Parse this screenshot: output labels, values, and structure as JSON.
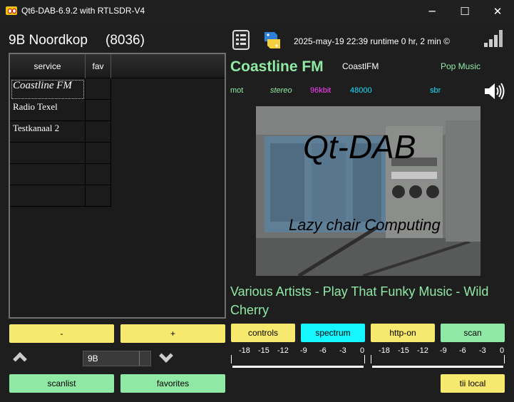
{
  "window": {
    "title": "Qt6-DAB-6.9.2 with RTLSDR-V4",
    "minimize": "─",
    "maximize": "☐",
    "close": "✕"
  },
  "ensemble": {
    "name": "9B Noordkop",
    "id": "(8036)"
  },
  "services": {
    "headers": {
      "service": "service",
      "fav": "fav"
    },
    "rows": [
      "Coastline FM",
      "Radio Texel",
      "Testkanaal 2",
      "",
      "",
      ""
    ]
  },
  "buttons": {
    "minus": "-",
    "plus": "+",
    "scanlist": "scanlist",
    "favorites": "favorites",
    "controls": "controls",
    "spectrum": "spectrum",
    "http": "http-on",
    "scan": "scan",
    "tii": "tii local"
  },
  "channel": {
    "selected": "9B"
  },
  "status": {
    "datetime": "2025-may-19  22:39  runtime 0 hr, 2 min  ©"
  },
  "station": {
    "name": "Coastline FM",
    "short": "CoastlFM",
    "genre": "Pop Music"
  },
  "audio_info": {
    "mode": "mot",
    "channels": "stereo",
    "bitrate": "96kbit",
    "samplerate": "48000",
    "sbr": "sbr"
  },
  "slide": {
    "title": "Qt-DAB",
    "subtitle": "Lazy chair Computing"
  },
  "dynamic_label": "Various Artists - Play That Funky Music - Wild Cherry",
  "meter": {
    "scale": [
      "-18",
      "-15",
      "-12",
      "-9",
      "-6",
      "-3",
      "0"
    ]
  },
  "colors": {
    "accent_green": "#8fe9a4",
    "button_yellow": "#f7e96e",
    "button_cyan": "#16f6ff",
    "mot": "#8fe9a4",
    "stereo": "#8fe9a4",
    "bitrate": "#ff3cff",
    "samplerate": "#16e0ff",
    "sbr": "#16e0ff"
  },
  "icons": {
    "app": "radio-app-icon",
    "technical": "technical-data-icon",
    "python": "python-icon",
    "signal": "signal-strength-icon",
    "speaker": "speaker-icon",
    "up": "chevron-up-icon",
    "down": "chevron-down-icon"
  }
}
